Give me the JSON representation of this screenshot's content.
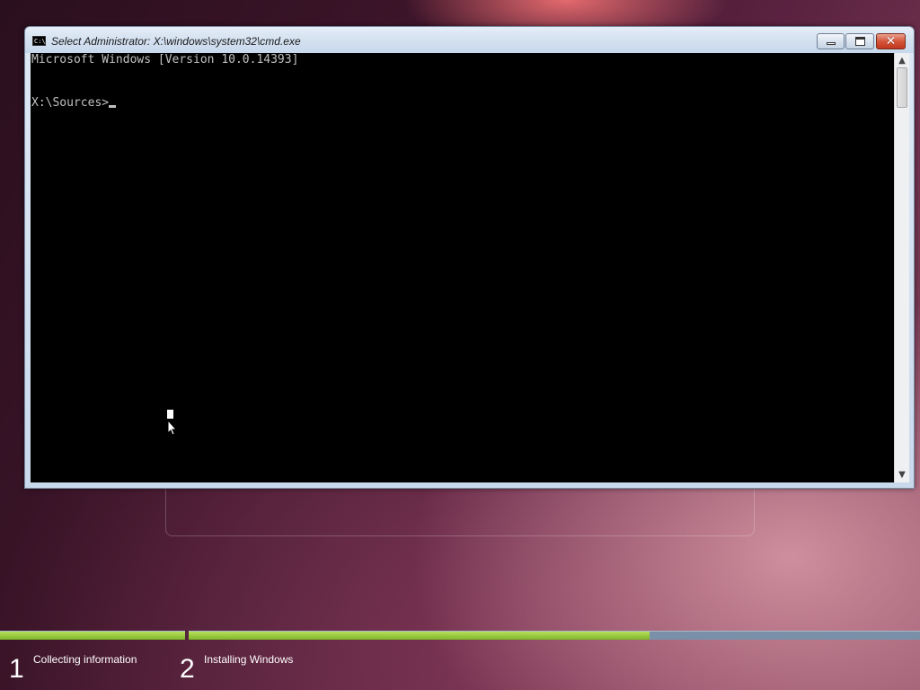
{
  "window": {
    "title": "Select Administrator: X:\\windows\\system32\\cmd.exe",
    "icon": "cmd-console-icon",
    "buttons": {
      "minimize_icon": "minimize-icon",
      "maximize_icon": "maximize-icon",
      "close_icon": "close-icon",
      "close_glyph": "✕"
    }
  },
  "console": {
    "lines": [
      "Microsoft Windows [Version 10.0.14393]",
      "",
      "X:\\Sources>"
    ],
    "background": "#000000",
    "foreground": "#c0c0c0"
  },
  "scrollbar": {
    "up_glyph": "▲",
    "down_glyph": "▼"
  },
  "setup": {
    "progress": {
      "step1_fraction": 1.0,
      "step2_fraction": 0.63,
      "fill_color": "#8cc63f",
      "track_color": "#7a90a8"
    },
    "steps": [
      {
        "number": "1",
        "label": "Collecting information"
      },
      {
        "number": "2",
        "label": "Installing Windows"
      }
    ]
  }
}
